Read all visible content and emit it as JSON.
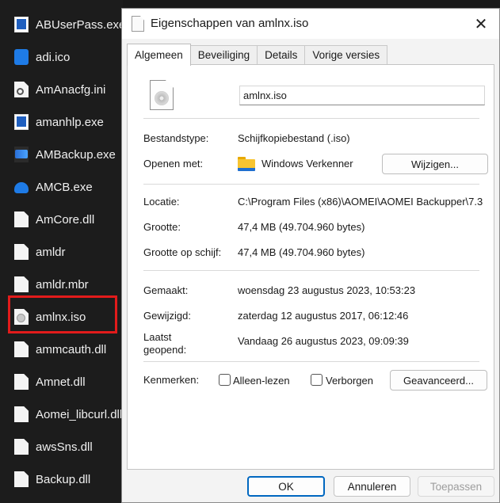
{
  "explorer": {
    "files": [
      {
        "name": "ABUserPass.exe",
        "icon": "exe-icon"
      },
      {
        "name": "adi.ico",
        "icon": "ico-icon"
      },
      {
        "name": "AmAnacfg.ini",
        "icon": "ini-settings-icon"
      },
      {
        "name": "amanhlp.exe",
        "icon": "exe-icon"
      },
      {
        "name": "AMBackup.exe",
        "icon": "aomei-backup-icon"
      },
      {
        "name": "AMCB.exe",
        "icon": "cloud-upload-icon"
      },
      {
        "name": "AmCore.dll",
        "icon": "dll-icon"
      },
      {
        "name": "amldr",
        "icon": "file-icon"
      },
      {
        "name": "amldr.mbr",
        "icon": "file-icon"
      },
      {
        "name": "amlnx.iso",
        "icon": "disc-image-icon"
      },
      {
        "name": "ammcauth.dll",
        "icon": "dll-icon"
      },
      {
        "name": "Amnet.dll",
        "icon": "dll-icon"
      },
      {
        "name": "Aomei_libcurl.dll",
        "icon": "dll-icon"
      },
      {
        "name": "awsSns.dll",
        "icon": "dll-icon"
      },
      {
        "name": "Backup.dll",
        "icon": "dll-icon"
      }
    ],
    "highlight_color": "#e21b1b"
  },
  "dialog": {
    "title": "Eigenschappen van amlnx.iso",
    "close_glyph": "✕",
    "tabs": [
      "Algemeen",
      "Beveiliging",
      "Details",
      "Vorige versies"
    ],
    "active_tab": "Algemeen",
    "filename": "amlnx.iso",
    "type_label": "Bestandstype:",
    "type_value": "Schijfkopiebestand (.iso)",
    "opens_with_label": "Openen met:",
    "opens_with_value": "Windows Verkenner",
    "change_button": "Wijzigen...",
    "location_label": "Locatie:",
    "location_value": "C:\\Program Files (x86)\\AOMEI\\AOMEI Backupper\\7.3",
    "size_label": "Grootte:",
    "size_value": "47,4 MB (49.704.960 bytes)",
    "size_on_disk_label": "Grootte op schijf:",
    "size_on_disk_value": "47,4 MB (49.704.960 bytes)",
    "created_label": "Gemaakt:",
    "created_value": "woensdag 23 augustus 2023, 10:53:23",
    "modified_label": "Gewijzigd:",
    "modified_value": "zaterdag 12 augustus 2017, 06:12:46",
    "accessed_label_line1": "Laatst",
    "accessed_label_line2": "geopend:",
    "accessed_value": "Vandaag 26 augustus 2023, 09:09:39",
    "attributes_label": "Kenmerken:",
    "readonly_label": "Alleen-lezen",
    "hidden_label": "Verborgen",
    "advanced_button": "Geavanceerd...",
    "ok_button": "OK",
    "cancel_button": "Annuleren",
    "apply_button": "Toepassen",
    "accent_color": "#0067c0"
  }
}
